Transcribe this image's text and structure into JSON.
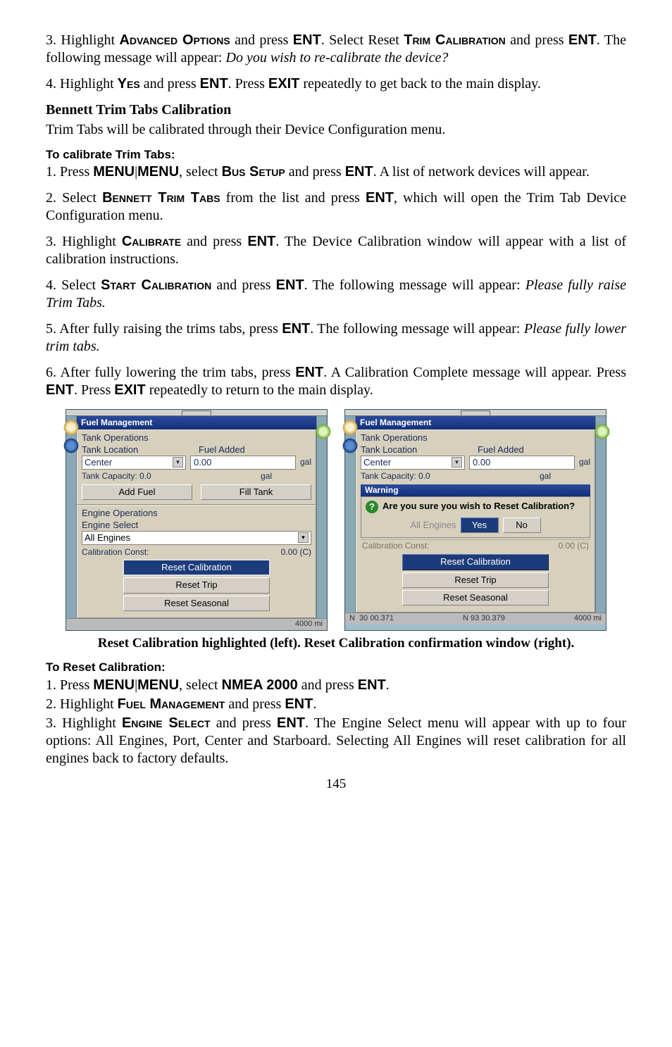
{
  "p1": {
    "prefix": "3. Highlight ",
    "sc1": "Advanced Options",
    "mid1": " and press ",
    "b1": "ENT",
    "mid2": ". Select Reset ",
    "sc2": "Trim Calibration",
    "mid3": " and press ",
    "b2": "ENT",
    "suffix": ". The following message will appear: ",
    "italic": "Do you wish to re-calibrate the device?"
  },
  "p2": {
    "prefix": "4. Highlight ",
    "sc1": "Yes",
    "mid1": " and press ",
    "b1": "ENT",
    "mid2": ". Press ",
    "b2": "EXIT",
    "suffix": " repeatedly to get back to the main display."
  },
  "h1": "Bennett Trim Tabs Calibration",
  "p3": "Trim Tabs will be calibrated through their Device Configuration menu.",
  "sh1": "To calibrate Trim Tabs:",
  "p4": {
    "prefix": "1. Press ",
    "b1": "MENU",
    "sep": "|",
    "b2": "MENU",
    "mid1": ", select ",
    "sc1": "Bus Setup",
    "mid2": " and press ",
    "b3": "ENT",
    "suffix": ". A list of network devices will appear."
  },
  "p5": {
    "prefix": "2. Select ",
    "sc1": "Bennett Trim Tabs",
    "mid1": " from the list and press ",
    "b1": "ENT",
    "suffix": ", which will open the Trim Tab Device Configuration menu."
  },
  "p6": {
    "prefix": "3. Highlight ",
    "sc1": "Calibrate",
    "mid1": " and press ",
    "b1": "ENT",
    "suffix": ". The Device Calibration window will appear with a list of calibration instructions."
  },
  "p7": {
    "prefix": "4. Select ",
    "sc1": "Start Calibration",
    "mid1": " and press ",
    "b1": "ENT",
    "suffix": ". The following message will appear: ",
    "italic": "Please fully raise Trim Tabs."
  },
  "p8": {
    "prefix": "5. After fully raising the trims tabs, press ",
    "b1": "ENT",
    "suffix": ". The following message will appear: ",
    "italic": "Please fully lower trim tabs."
  },
  "p9": {
    "prefix": "6. After fully lowering the trim tabs, press ",
    "b1": "ENT",
    "mid1": ". A Calibration Complete message will appear. Press ",
    "b2": "ENT",
    "mid2": ". Press ",
    "b3": "EXIT",
    "suffix": " repeatedly to return to the main display."
  },
  "caption": "Reset Calibration highlighted (left). Reset Calibration confirmation window (right).",
  "sh2": "To Reset Calibration:",
  "p10": {
    "prefix": "1. Press ",
    "b1": "MENU",
    "sep": "|",
    "b2": "MENU",
    "mid1": ", select ",
    "b3": "NMEA 2000",
    "mid2": " and press ",
    "b4": "ENT",
    "suffix": "."
  },
  "p11": {
    "prefix": "2. Highlight ",
    "sc1": "Fuel Management",
    "mid1": " and press ",
    "b1": "ENT",
    "suffix": "."
  },
  "p12": {
    "prefix": "3. Highlight ",
    "sc1": "Engine Select",
    "mid1": " and press ",
    "b1": "ENT",
    "suffix": ". The Engine Select menu will appear with up to four options: All Engines, Port, Center and Starboard. Selecting All Engines will reset calibration for all engines back to factory defaults."
  },
  "page": "145",
  "left": {
    "title": "Fuel Management",
    "tank_ops": "Tank Operations",
    "tank_loc_lbl": "Tank Location",
    "tank_loc_val": "Center",
    "fuel_added_lbl": "Fuel Added",
    "fuel_added_val": "0.00",
    "gal": "gal",
    "tank_cap": "Tank Capacity: 0.0",
    "add_fuel": "Add Fuel",
    "fill_tank": "Fill Tank",
    "eng_ops": "Engine Operations",
    "eng_sel": "Engine Select",
    "all_eng": "All Engines",
    "cal_const": "Calibration Const:",
    "cal_val": "0.00 (C)",
    "reset_cal": "Reset Calibration",
    "reset_trip": "Reset Trip",
    "reset_seasonal": "Reset Seasonal",
    "foot": "4000 mi"
  },
  "right": {
    "title": "Fuel Management",
    "tank_ops": "Tank Operations",
    "tank_loc_lbl": "Tank Location",
    "tank_loc_val": "Center",
    "fuel_added_lbl": "Fuel Added",
    "fuel_added_val": "0.00",
    "gal": "gal",
    "tank_cap": "Tank Capacity: 0.0",
    "warning": "Warning",
    "msg": "Are you sure you wish to Reset Calibration?",
    "yes": "Yes",
    "no": "No",
    "all_eng_ghost": "All Engines",
    "cal_const": "Calibration Const:",
    "cal_val": "0.00 (C)",
    "reset_cal": "Reset Calibration",
    "reset_trip": "Reset Trip",
    "reset_seasonal": "Reset Seasonal",
    "foot_l": "30 00.371",
    "foot_m": "N     93 30.379",
    "foot_r": "4000 mi"
  }
}
